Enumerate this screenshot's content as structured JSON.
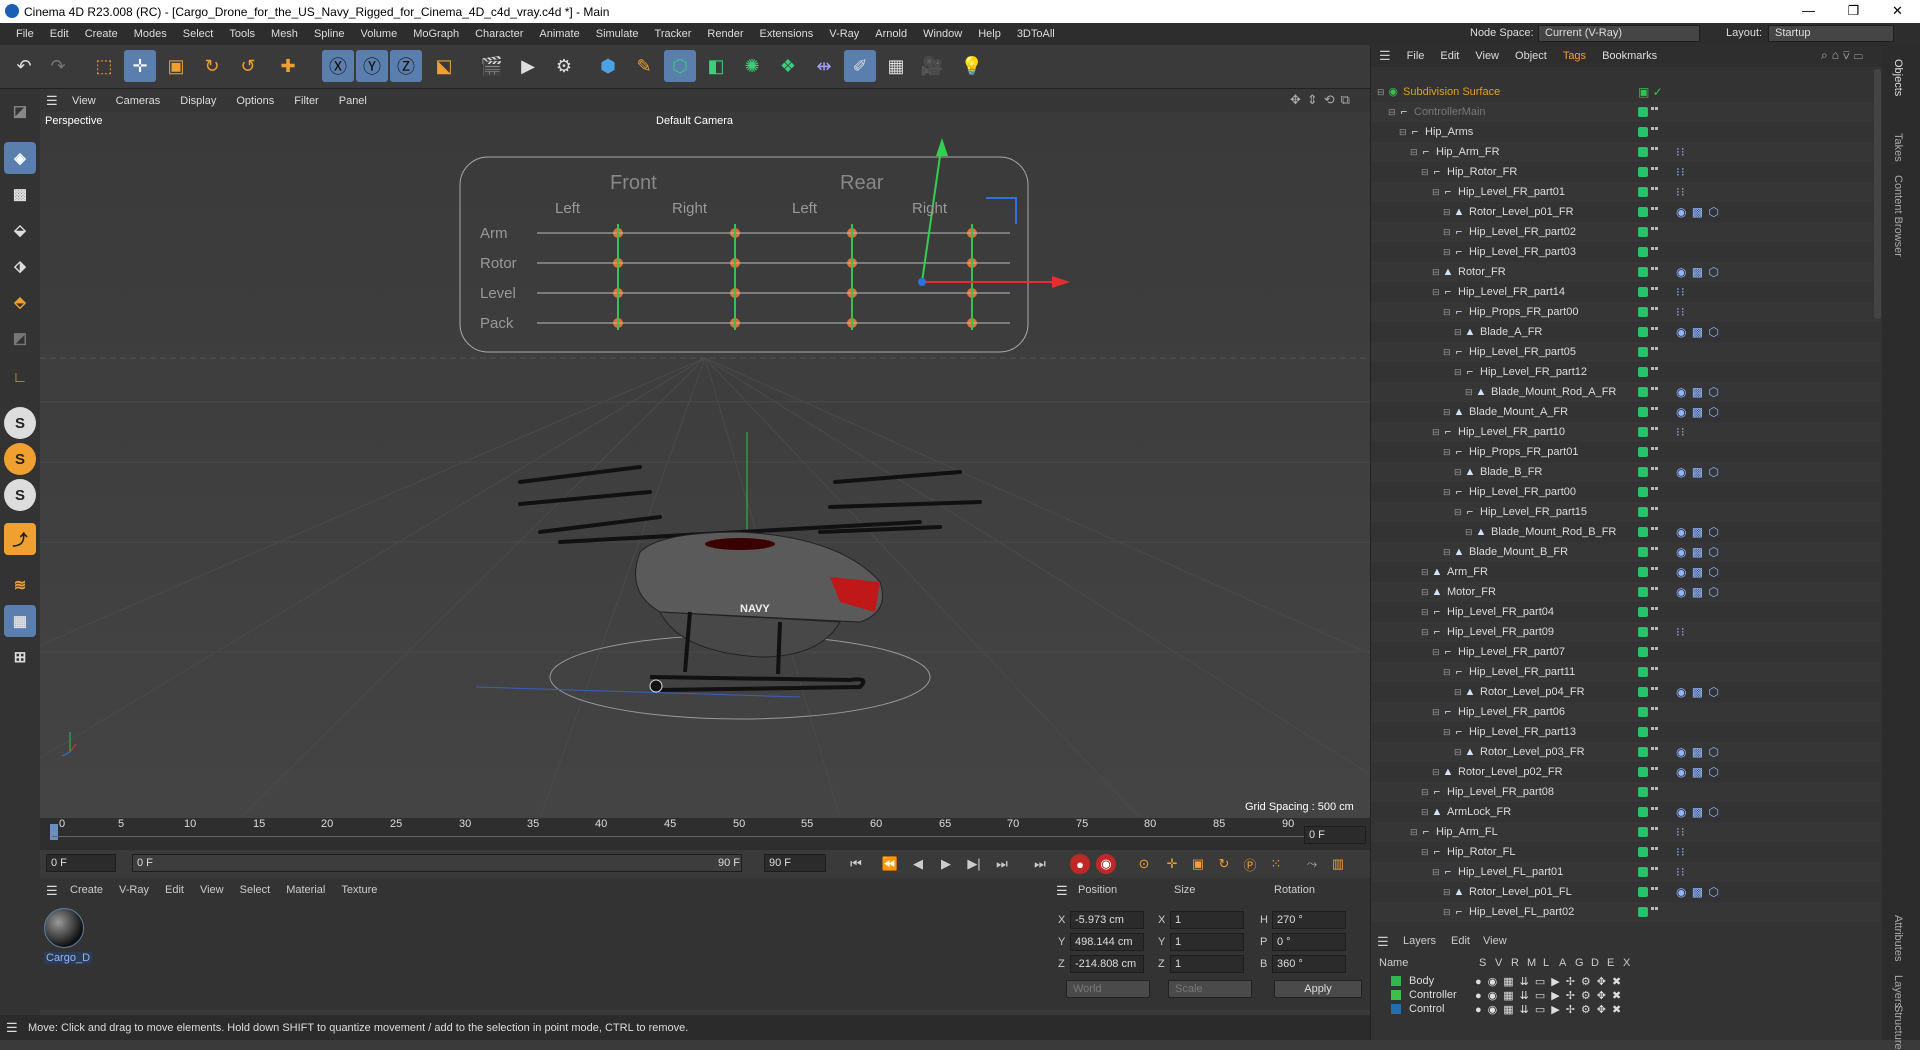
{
  "window": {
    "title": "Cinema 4D R23.008 (RC) - [Cargo_Drone_for_the_US_Navy_Rigged_for_Cinema_4D_c4d_vray.c4d *] - Main"
  },
  "menubar": {
    "items": [
      "File",
      "Edit",
      "Create",
      "Modes",
      "Select",
      "Tools",
      "Mesh",
      "Spline",
      "Volume",
      "MoGraph",
      "Character",
      "Animate",
      "Simulate",
      "Tracker",
      "Render",
      "Extensions",
      "V-Ray",
      "Arnold",
      "Window",
      "Help",
      "3DToAll"
    ],
    "node_space_label": "Node Space:",
    "node_space_value": "Current (V-Ray)",
    "layout_label": "Layout:",
    "layout_value": "Startup"
  },
  "viewport": {
    "menu": [
      "View",
      "Cameras",
      "Display",
      "Options",
      "Filter",
      "Panel"
    ],
    "name": "Perspective",
    "camera": "Default Camera",
    "grid_spacing": "Grid Spacing : 500 cm",
    "hud": {
      "front": "Front",
      "rear": "Rear",
      "cols": [
        "Left",
        "Right",
        "Left",
        "Right"
      ],
      "rows": [
        "Arm",
        "Rotor",
        "Level",
        "Pack"
      ]
    },
    "drone_text": "NAVY"
  },
  "timeline": {
    "ticks": [
      "0",
      "5",
      "10",
      "15",
      "20",
      "25",
      "30",
      "35",
      "40",
      "45",
      "50",
      "55",
      "60",
      "65",
      "70",
      "75",
      "80",
      "85",
      "90"
    ],
    "current_frame_right": "0 F",
    "start": "0 F",
    "range_start": "0 F",
    "range_end": "90 F",
    "end": "90 F"
  },
  "material_manager": {
    "menu": [
      "Create",
      "V-Ray",
      "Edit",
      "View",
      "Select",
      "Material",
      "Texture"
    ],
    "material_name": "Cargo_D"
  },
  "coordinates": {
    "headers": {
      "position": "Position",
      "size": "Size",
      "rotation": "Rotation"
    },
    "rows": [
      {
        "axis": "X",
        "pos": "-5.973 cm",
        "saxis": "X",
        "size": "1",
        "raxis": "H",
        "rot": "270 °"
      },
      {
        "axis": "Y",
        "pos": "498.144 cm",
        "saxis": "Y",
        "size": "1",
        "raxis": "P",
        "rot": "0 °"
      },
      {
        "axis": "Z",
        "pos": "-214.808 cm",
        "saxis": "Z",
        "size": "1",
        "raxis": "B",
        "rot": "360 °"
      }
    ],
    "world": "World",
    "scale": "Scale",
    "apply": "Apply"
  },
  "status": "Move: Click and drag to move elements. Hold down SHIFT to quantize movement / add to the selection in point mode, CTRL to remove.",
  "object_manager": {
    "menu": [
      "File",
      "Edit",
      "View",
      "Object",
      "Tags",
      "Bookmarks"
    ],
    "rows": [
      {
        "name": "Subdivision Surface",
        "indent": 0,
        "tags": "",
        "color": "#e0a020"
      },
      {
        "name": "ControllerMain",
        "indent": 1,
        "tags": "",
        "color": "#777"
      },
      {
        "name": "Hip_Arms",
        "indent": 2,
        "tags": "",
        "color": "#ddd"
      },
      {
        "name": "Hip_Arm_FR",
        "indent": 3,
        "tags": "⁝⁝",
        "color": "#ddd"
      },
      {
        "name": "Hip_Rotor_FR",
        "indent": 4,
        "tags": "⁝⁝",
        "color": "#ddd"
      },
      {
        "name": "Hip_Level_FR_part01",
        "indent": 5,
        "tags": "⁝⁝",
        "color": "#ddd"
      },
      {
        "name": "Rotor_Level_p01_FR",
        "indent": 6,
        "tags": "◉ ▩ ⬡",
        "color": "#ddd"
      },
      {
        "name": "Hip_Level_FR_part02",
        "indent": 6,
        "tags": "",
        "color": "#ddd"
      },
      {
        "name": "Hip_Level_FR_part03",
        "indent": 6,
        "tags": "",
        "color": "#ddd"
      },
      {
        "name": "Rotor_FR",
        "indent": 5,
        "tags": "◉ ▩ ⬡",
        "color": "#ddd"
      },
      {
        "name": "Hip_Level_FR_part14",
        "indent": 5,
        "tags": "⁝⁝",
        "color": "#ddd"
      },
      {
        "name": "Hip_Props_FR_part00",
        "indent": 6,
        "tags": "⁝⁝",
        "color": "#ddd"
      },
      {
        "name": "Blade_A_FR",
        "indent": 7,
        "tags": "◉ ▩ ⬡",
        "color": "#ddd"
      },
      {
        "name": "Hip_Level_FR_part05",
        "indent": 6,
        "tags": "",
        "color": "#ddd"
      },
      {
        "name": "Hip_Level_FR_part12",
        "indent": 7,
        "tags": "",
        "color": "#ddd"
      },
      {
        "name": "Blade_Mount_Rod_A_FR",
        "indent": 8,
        "tags": "◉ ▩ ⬡",
        "color": "#ddd"
      },
      {
        "name": "Blade_Mount_A_FR",
        "indent": 6,
        "tags": "◉ ▩ ⬡",
        "color": "#ddd"
      },
      {
        "name": "Hip_Level_FR_part10",
        "indent": 5,
        "tags": "⁝⁝",
        "color": "#ddd"
      },
      {
        "name": "Hip_Props_FR_part01",
        "indent": 6,
        "tags": "",
        "color": "#ddd"
      },
      {
        "name": "Blade_B_FR",
        "indent": 7,
        "tags": "◉ ▩ ⬡",
        "color": "#ddd"
      },
      {
        "name": "Hip_Level_FR_part00",
        "indent": 6,
        "tags": "",
        "color": "#ddd"
      },
      {
        "name": "Hip_Level_FR_part15",
        "indent": 7,
        "tags": "",
        "color": "#ddd"
      },
      {
        "name": "Blade_Mount_Rod_B_FR",
        "indent": 8,
        "tags": "◉ ▩ ⬡",
        "color": "#ddd"
      },
      {
        "name": "Blade_Mount_B_FR",
        "indent": 6,
        "tags": "◉ ▩ ⬡",
        "color": "#ddd"
      },
      {
        "name": "Arm_FR",
        "indent": 4,
        "tags": "◉ ▩ ⬡",
        "color": "#ddd"
      },
      {
        "name": "Motor_FR",
        "indent": 4,
        "tags": "◉ ▩ ⬡",
        "color": "#ddd"
      },
      {
        "name": "Hip_Level_FR_part04",
        "indent": 4,
        "tags": "",
        "color": "#ddd"
      },
      {
        "name": "Hip_Level_FR_part09",
        "indent": 4,
        "tags": "⁝⁝",
        "color": "#ddd"
      },
      {
        "name": "Hip_Level_FR_part07",
        "indent": 5,
        "tags": "",
        "color": "#ddd"
      },
      {
        "name": "Hip_Level_FR_part11",
        "indent": 6,
        "tags": "",
        "color": "#ddd"
      },
      {
        "name": "Rotor_Level_p04_FR",
        "indent": 7,
        "tags": "◉ ▩ ⬡",
        "color": "#ddd"
      },
      {
        "name": "Hip_Level_FR_part06",
        "indent": 5,
        "tags": "",
        "color": "#ddd"
      },
      {
        "name": "Hip_Level_FR_part13",
        "indent": 6,
        "tags": "",
        "color": "#ddd"
      },
      {
        "name": "Rotor_Level_p03_FR",
        "indent": 7,
        "tags": "◉ ▩ ⬡",
        "color": "#ddd"
      },
      {
        "name": "Rotor_Level_p02_FR",
        "indent": 5,
        "tags": "◉ ▩ ⬡",
        "color": "#ddd"
      },
      {
        "name": "Hip_Level_FR_part08",
        "indent": 4,
        "tags": "",
        "color": "#ddd"
      },
      {
        "name": "ArmLock_FR",
        "indent": 4,
        "tags": "◉ ▩ ⬡",
        "color": "#ddd"
      },
      {
        "name": "Hip_Arm_FL",
        "indent": 3,
        "tags": "⁝⁝",
        "color": "#ddd"
      },
      {
        "name": "Hip_Rotor_FL",
        "indent": 4,
        "tags": "⁝⁝",
        "color": "#ddd"
      },
      {
        "name": "Hip_Level_FL_part01",
        "indent": 5,
        "tags": "⁝⁝",
        "color": "#ddd"
      },
      {
        "name": "Rotor_Level_p01_FL",
        "indent": 6,
        "tags": "◉ ▩ ⬡",
        "color": "#ddd"
      },
      {
        "name": "Hip_Level_FL_part02",
        "indent": 6,
        "tags": "",
        "color": "#ddd"
      }
    ]
  },
  "layers": {
    "menu": [
      "Layers",
      "Edit",
      "View"
    ],
    "header_name": "Name",
    "header_cols": [
      "S",
      "V",
      "R",
      "M",
      "L",
      "A",
      "G",
      "D",
      "E",
      "X"
    ],
    "items": [
      {
        "name": "Body",
        "color": "#2fb84f"
      },
      {
        "name": "Controller",
        "color": "#3cc04a"
      },
      {
        "name": "Control",
        "color": "#1f6fb5"
      }
    ]
  },
  "side_tabs": [
    "Objects",
    "Takes",
    "Content Browser",
    "Attributes",
    "Layers",
    "Structure"
  ]
}
